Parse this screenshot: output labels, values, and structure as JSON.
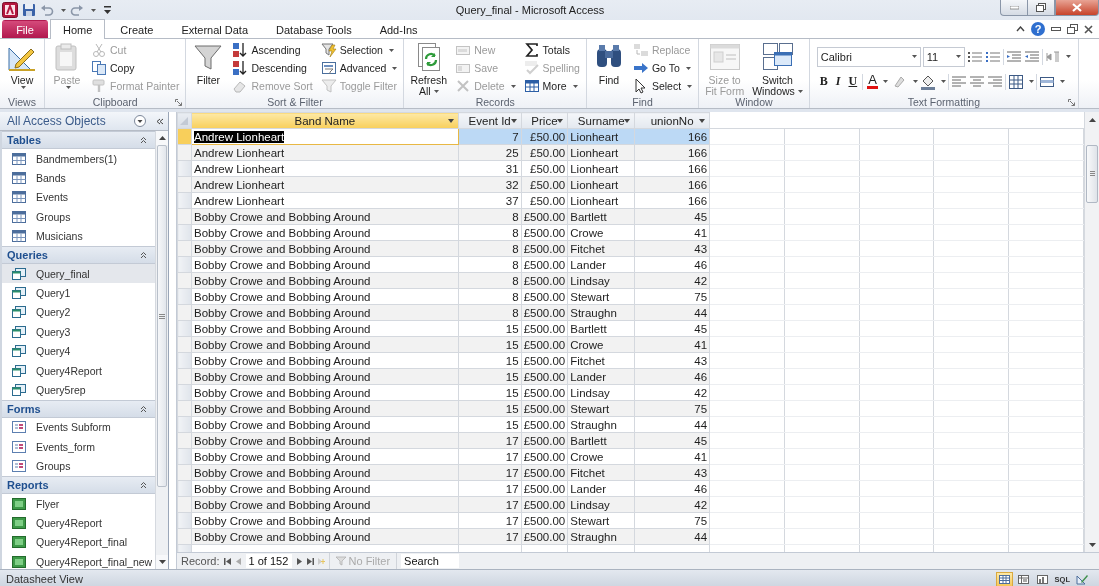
{
  "window": {
    "title": "Query_final  -  Microsoft Access",
    "help_label": "?"
  },
  "ribbon_tabs": [
    {
      "label": "File",
      "kind": "file",
      "selected": false
    },
    {
      "label": "Home",
      "kind": "tab",
      "selected": true
    },
    {
      "label": "Create",
      "kind": "tab",
      "selected": false
    },
    {
      "label": "External Data",
      "kind": "tab",
      "selected": false
    },
    {
      "label": "Database Tools",
      "kind": "tab",
      "selected": false
    },
    {
      "label": "Add-Ins",
      "kind": "tab",
      "selected": false
    }
  ],
  "ribbon_groups": [
    {
      "label": "Views",
      "kind": "buttons",
      "launcher": false,
      "columns": [
        [
          {
            "kind": "large",
            "label_lines": [
              "View"
            ],
            "dropdown": true,
            "disabled": false
          }
        ]
      ]
    },
    {
      "label": "Clipboard",
      "kind": "buttons",
      "launcher": true,
      "columns": [
        [
          {
            "kind": "large",
            "label_lines": [
              "Paste"
            ],
            "dropdown": true,
            "disabled": true
          }
        ],
        [
          {
            "kind": "small",
            "label": "Cut",
            "dropdown": false,
            "disabled": true
          },
          {
            "kind": "small",
            "label": "Copy",
            "dropdown": false,
            "disabled": false
          },
          {
            "kind": "small",
            "label": "Format Painter",
            "dropdown": false,
            "disabled": true
          }
        ]
      ]
    },
    {
      "label": "Sort & Filter",
      "kind": "buttons",
      "launcher": false,
      "columns": [
        [
          {
            "kind": "large",
            "label_lines": [
              "Filter"
            ],
            "dropdown": false,
            "disabled": false
          }
        ],
        [
          {
            "kind": "small",
            "label": "Ascending",
            "dropdown": false,
            "disabled": false
          },
          {
            "kind": "small",
            "label": "Descending",
            "dropdown": false,
            "disabled": false
          },
          {
            "kind": "small",
            "label": "Remove Sort",
            "dropdown": false,
            "disabled": true
          }
        ],
        [
          {
            "kind": "small",
            "label": "Selection",
            "dropdown": true,
            "disabled": false
          },
          {
            "kind": "small",
            "label": "Advanced",
            "dropdown": true,
            "disabled": false
          },
          {
            "kind": "small",
            "label": "Toggle Filter",
            "dropdown": false,
            "disabled": true
          }
        ]
      ]
    },
    {
      "label": "Records",
      "kind": "buttons",
      "launcher": false,
      "columns": [
        [
          {
            "kind": "large",
            "label_lines": [
              "Refresh",
              "All"
            ],
            "dropdown": true,
            "disabled": false
          }
        ],
        [
          {
            "kind": "small",
            "label": "New",
            "dropdown": false,
            "disabled": true
          },
          {
            "kind": "small",
            "label": "Save",
            "dropdown": false,
            "disabled": true
          },
          {
            "kind": "small",
            "label": "Delete",
            "dropdown": true,
            "disabled": true
          }
        ],
        [
          {
            "kind": "small",
            "label": "Totals",
            "dropdown": false,
            "disabled": false
          },
          {
            "kind": "small",
            "label": "Spelling",
            "dropdown": false,
            "disabled": true
          },
          {
            "kind": "small",
            "label": "More",
            "dropdown": true,
            "disabled": false
          }
        ]
      ]
    },
    {
      "label": "Find",
      "kind": "buttons",
      "launcher": false,
      "columns": [
        [
          {
            "kind": "large",
            "label_lines": [
              "Find"
            ],
            "dropdown": false,
            "disabled": false
          }
        ],
        [
          {
            "kind": "small",
            "label": "Replace",
            "dropdown": false,
            "disabled": true
          },
          {
            "kind": "small",
            "label": "Go To",
            "dropdown": true,
            "disabled": false
          },
          {
            "kind": "small",
            "label": "Select",
            "dropdown": true,
            "disabled": false
          }
        ]
      ]
    },
    {
      "label": "Window",
      "kind": "buttons",
      "launcher": false,
      "columns": [
        [
          {
            "kind": "large",
            "label_lines": [
              "Size to",
              "Fit Form"
            ],
            "dropdown": false,
            "disabled": true
          }
        ],
        [
          {
            "kind": "large",
            "label_lines": [
              "Switch",
              "Windows"
            ],
            "dropdown": true,
            "disabled": false
          }
        ]
      ]
    },
    {
      "label": "Text Formatting",
      "kind": "format",
      "launcher": true,
      "font": "Calibri",
      "size": "11",
      "bold": "B",
      "italic": "I",
      "underline": "U",
      "font_color": "A"
    }
  ],
  "nav_pane": {
    "title": "All Access Objects",
    "groups": [
      {
        "label": "Tables",
        "kind": "table",
        "expanded": true,
        "items": [
          {
            "label": "Bandmembers(1)",
            "selected": false
          },
          {
            "label": "Bands",
            "selected": false
          },
          {
            "label": "Events",
            "selected": false
          },
          {
            "label": "Groups",
            "selected": false
          },
          {
            "label": "Musicians",
            "selected": false
          }
        ]
      },
      {
        "label": "Queries",
        "kind": "query",
        "expanded": true,
        "items": [
          {
            "label": "Query_final",
            "selected": true
          },
          {
            "label": "Query1",
            "selected": false
          },
          {
            "label": "Query2",
            "selected": false
          },
          {
            "label": "Query3",
            "selected": false
          },
          {
            "label": "Query4",
            "selected": false
          },
          {
            "label": "Query4Report",
            "selected": false
          },
          {
            "label": "Query5rep",
            "selected": false
          }
        ]
      },
      {
        "label": "Forms",
        "kind": "form",
        "expanded": true,
        "items": [
          {
            "label": "Events Subform",
            "selected": false
          },
          {
            "label": "Events_form",
            "selected": false
          },
          {
            "label": "Groups",
            "selected": false
          }
        ]
      },
      {
        "label": "Reports",
        "kind": "report",
        "expanded": true,
        "items": [
          {
            "label": "Flyer",
            "selected": false
          },
          {
            "label": "Query4Report",
            "selected": false
          },
          {
            "label": "Query4Report_final",
            "selected": false
          },
          {
            "label": "Query4Report_final_new",
            "selected": false
          }
        ]
      }
    ]
  },
  "datasheet": {
    "columns": [
      {
        "label": "Band Name",
        "kind": "text",
        "selected": true
      },
      {
        "label": "Event Id",
        "kind": "number",
        "selected": false
      },
      {
        "label": "Price",
        "kind": "number",
        "selected": false
      },
      {
        "label": "Surname",
        "kind": "text",
        "selected": false
      },
      {
        "label": "unionNo",
        "kind": "number",
        "selected": false
      }
    ],
    "rows": [
      {
        "cells": [
          "Andrew Lionheart",
          "7",
          "£50.00",
          "Lionheart",
          "166"
        ],
        "selected": true
      },
      {
        "cells": [
          "Andrew Lionheart",
          "25",
          "£50.00",
          "Lionheart",
          "166"
        ],
        "selected": false
      },
      {
        "cells": [
          "Andrew Lionheart",
          "31",
          "£50.00",
          "Lionheart",
          "166"
        ],
        "selected": false
      },
      {
        "cells": [
          "Andrew Lionheart",
          "32",
          "£50.00",
          "Lionheart",
          "166"
        ],
        "selected": false
      },
      {
        "cells": [
          "Andrew Lionheart",
          "37",
          "£50.00",
          "Lionheart",
          "166"
        ],
        "selected": false
      },
      {
        "cells": [
          "Bobby Crowe and Bobbing Around",
          "8",
          "£500.00",
          "Bartlett",
          "45"
        ],
        "selected": false
      },
      {
        "cells": [
          "Bobby Crowe and Bobbing Around",
          "8",
          "£500.00",
          "Crowe",
          "41"
        ],
        "selected": false
      },
      {
        "cells": [
          "Bobby Crowe and Bobbing Around",
          "8",
          "£500.00",
          "Fitchet",
          "43"
        ],
        "selected": false
      },
      {
        "cells": [
          "Bobby Crowe and Bobbing Around",
          "8",
          "£500.00",
          "Lander",
          "46"
        ],
        "selected": false
      },
      {
        "cells": [
          "Bobby Crowe and Bobbing Around",
          "8",
          "£500.00",
          "Lindsay",
          "42"
        ],
        "selected": false
      },
      {
        "cells": [
          "Bobby Crowe and Bobbing Around",
          "8",
          "£500.00",
          "Stewart",
          "75"
        ],
        "selected": false
      },
      {
        "cells": [
          "Bobby Crowe and Bobbing Around",
          "8",
          "£500.00",
          "Straughn",
          "44"
        ],
        "selected": false
      },
      {
        "cells": [
          "Bobby Crowe and Bobbing Around",
          "15",
          "£500.00",
          "Bartlett",
          "45"
        ],
        "selected": false
      },
      {
        "cells": [
          "Bobby Crowe and Bobbing Around",
          "15",
          "£500.00",
          "Crowe",
          "41"
        ],
        "selected": false
      },
      {
        "cells": [
          "Bobby Crowe and Bobbing Around",
          "15",
          "£500.00",
          "Fitchet",
          "43"
        ],
        "selected": false
      },
      {
        "cells": [
          "Bobby Crowe and Bobbing Around",
          "15",
          "£500.00",
          "Lander",
          "46"
        ],
        "selected": false
      },
      {
        "cells": [
          "Bobby Crowe and Bobbing Around",
          "15",
          "£500.00",
          "Lindsay",
          "42"
        ],
        "selected": false
      },
      {
        "cells": [
          "Bobby Crowe and Bobbing Around",
          "15",
          "£500.00",
          "Stewart",
          "75"
        ],
        "selected": false
      },
      {
        "cells": [
          "Bobby Crowe and Bobbing Around",
          "15",
          "£500.00",
          "Straughn",
          "44"
        ],
        "selected": false
      },
      {
        "cells": [
          "Bobby Crowe and Bobbing Around",
          "17",
          "£500.00",
          "Bartlett",
          "45"
        ],
        "selected": false
      },
      {
        "cells": [
          "Bobby Crowe and Bobbing Around",
          "17",
          "£500.00",
          "Crowe",
          "41"
        ],
        "selected": false
      },
      {
        "cells": [
          "Bobby Crowe and Bobbing Around",
          "17",
          "£500.00",
          "Fitchet",
          "43"
        ],
        "selected": false
      },
      {
        "cells": [
          "Bobby Crowe and Bobbing Around",
          "17",
          "£500.00",
          "Lander",
          "46"
        ],
        "selected": false
      },
      {
        "cells": [
          "Bobby Crowe and Bobbing Around",
          "17",
          "£500.00",
          "Lindsay",
          "42"
        ],
        "selected": false
      },
      {
        "cells": [
          "Bobby Crowe and Bobbing Around",
          "17",
          "£500.00",
          "Stewart",
          "75"
        ],
        "selected": false
      },
      {
        "cells": [
          "Bobby Crowe and Bobbing Around",
          "17",
          "£500.00",
          "Straughn",
          "44"
        ],
        "selected": false
      }
    ]
  },
  "record_bar": {
    "label": "Record:",
    "position": "1 of 152",
    "filter": "No Filter",
    "search_placeholder": "Search"
  },
  "status_bar": {
    "text": "Datasheet View",
    "views": [
      {
        "kind": "datasheet",
        "selected": true
      },
      {
        "kind": "pivot_table",
        "selected": false
      },
      {
        "kind": "pivot_chart",
        "selected": false
      },
      {
        "kind": "sql",
        "label": "SQL",
        "selected": false
      },
      {
        "kind": "design",
        "selected": false
      }
    ]
  }
}
